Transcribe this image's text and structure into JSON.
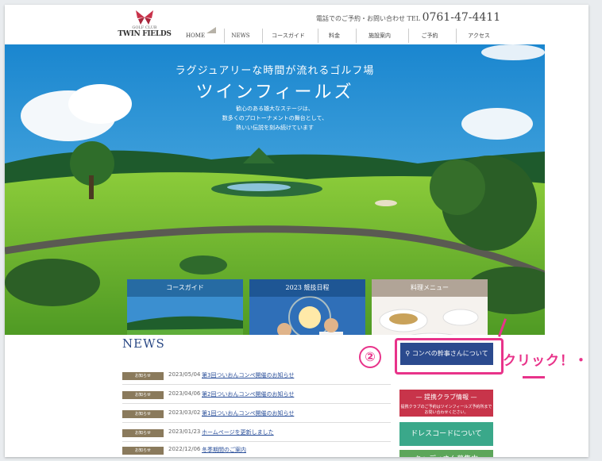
{
  "header": {
    "logo_sub": "GOLF CLUB",
    "logo_name": "TWIN FIELDS",
    "tel_label": "電話でのご予約・お問い合わせ TEL",
    "tel_number": "0761-47-4411"
  },
  "nav": {
    "items": [
      "HOME",
      "NEWS",
      "コースガイド",
      "料金",
      "施設案内",
      "ご予約",
      "アクセス"
    ]
  },
  "hero": {
    "title1": "ラグジュアリーな時間が流れるゴルフ場",
    "title2": "ツインフィールズ",
    "desc": [
      "歓心のある雄大なステージは、",
      "数多くのプロトーナメントの舞台として、",
      "熱いい伝説を刻み続けています"
    ]
  },
  "cards": [
    {
      "title": "コースガイド"
    },
    {
      "title": "2023 競技日程"
    },
    {
      "title": "料理メニュー"
    }
  ],
  "news": {
    "title": "NEWS",
    "items": [
      {
        "tag": "お知らせ",
        "date": "2023/05/04",
        "text": "第3回ついおんコンペ開催のお知らせ"
      },
      {
        "tag": "お知らせ",
        "date": "2023/04/06",
        "text": "第2回ついおんコンペ開催のお知らせ"
      },
      {
        "tag": "お知らせ",
        "date": "2023/03/02",
        "text": "第1回ついおんコンペ開催のお知らせ"
      },
      {
        "tag": "お知らせ",
        "date": "2023/01/23",
        "text": "ホームページを更新しました"
      },
      {
        "tag": "お知らせ",
        "date": "2022/12/06",
        "text": "冬季期間のご案内"
      }
    ]
  },
  "buttons": {
    "compe": "コンペの幹事さんについて",
    "teikei_head": "— 提携クラブ情報 —",
    "teikei_sub": "提携クラブのご予約はツインフィールズ予約所までお問い合わせください。",
    "dress": "ドレスコードについて",
    "caddie": "キャディさん募集中"
  },
  "annotation": {
    "step": "②",
    "click": "クリック！・"
  }
}
